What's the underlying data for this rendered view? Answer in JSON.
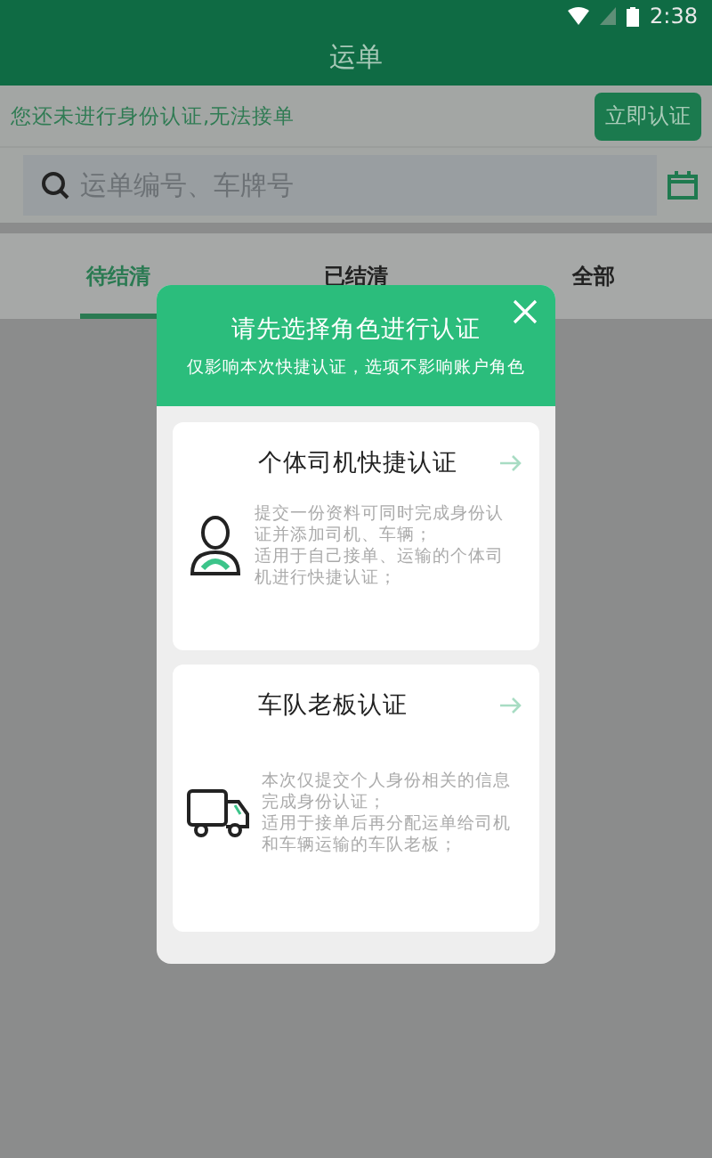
{
  "status_bar": {
    "time": "2:38"
  },
  "title": "运单",
  "notice": {
    "text": "您还未进行身份认证,无法接单",
    "button": "立即认证"
  },
  "search": {
    "placeholder": "运单编号、车牌号"
  },
  "tabs": [
    {
      "label": "待结清",
      "selected": true
    },
    {
      "label": "已结清",
      "selected": false
    },
    {
      "label": "全部",
      "selected": false
    }
  ],
  "dialog": {
    "title": "请先选择角色进行认证",
    "subtitle": "仅影响本次快捷认证，选项不影响账户角色",
    "options": [
      {
        "kind": "driver",
        "title": "个体司机快捷认证",
        "lines": [
          "提交一份资料可同时完成身份认证并添加司机、车辆；",
          "适用于自己接单、运输的个体司机进行快捷认证；"
        ]
      },
      {
        "kind": "fleet",
        "title": "车队老板认证",
        "lines": [
          "本次仅提交个人身份相关的信息完成身份认证；",
          "适用于接单后再分配运单给司机和车辆运输的车队老板；"
        ]
      }
    ]
  }
}
